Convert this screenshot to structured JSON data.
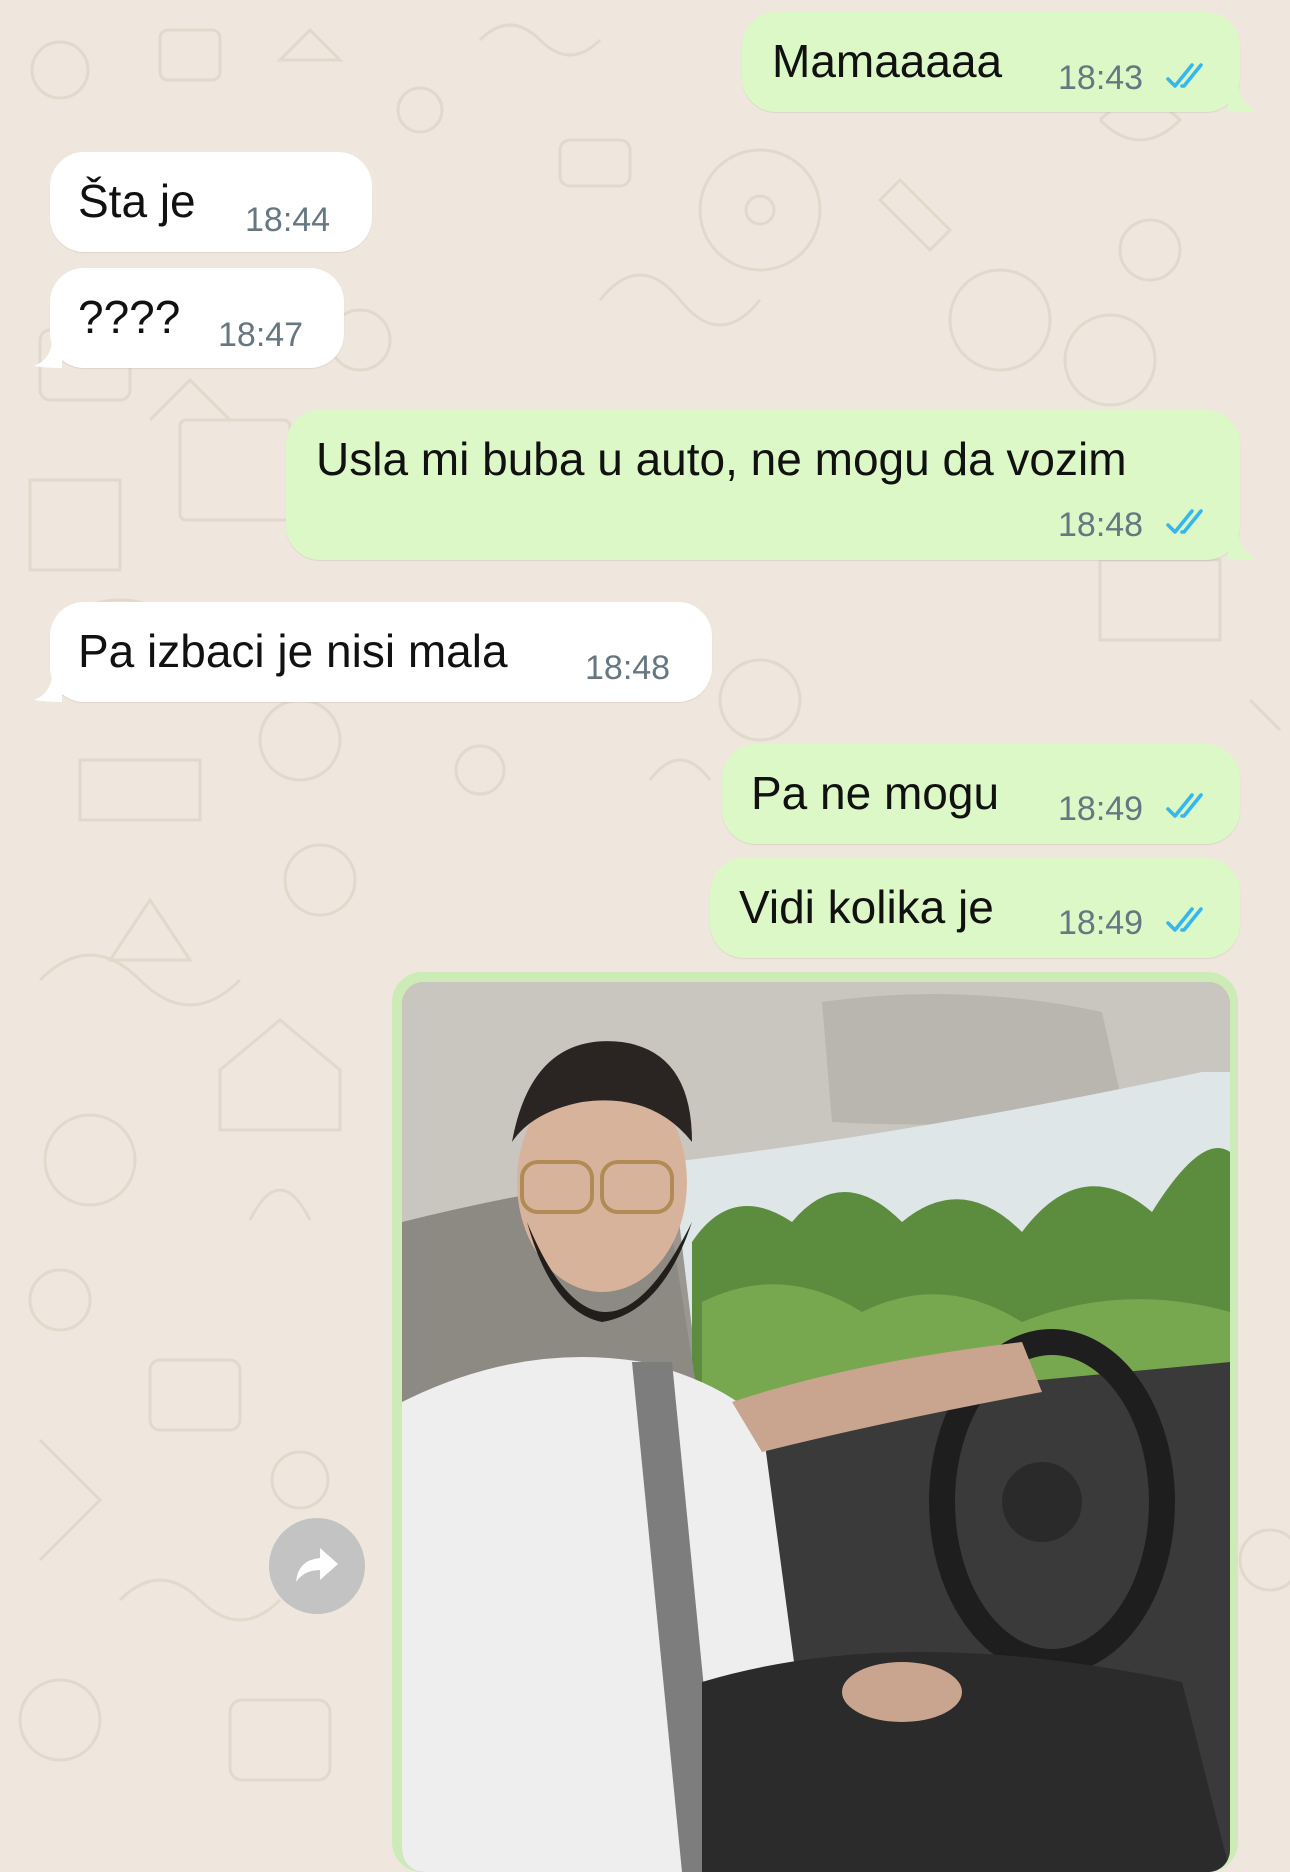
{
  "chat": {
    "messages": [
      {
        "id": "m1",
        "direction": "outgoing",
        "text": "Mamaaaaa",
        "time": "18:43",
        "status": "read"
      },
      {
        "id": "m2",
        "direction": "incoming",
        "text": "Šta je",
        "time": "18:44"
      },
      {
        "id": "m3",
        "direction": "incoming",
        "text": "????",
        "time": "18:47"
      },
      {
        "id": "m4",
        "direction": "outgoing",
        "text": "Usla mi buba u auto, ne mogu da vozim",
        "time": "18:48",
        "status": "read"
      },
      {
        "id": "m5",
        "direction": "incoming",
        "text": "Pa izbaci je nisi mala",
        "time": "18:48"
      },
      {
        "id": "m6",
        "direction": "outgoing",
        "text": "Pa ne mogu",
        "time": "18:49",
        "status": "read"
      },
      {
        "id": "m7",
        "direction": "outgoing",
        "text": "Vidi kolika je",
        "time": "18:49",
        "status": "read"
      },
      {
        "id": "m8",
        "direction": "outgoing",
        "type": "photo",
        "photo_subject": "man with beard and glasses in white t-shirt driving a car"
      }
    ]
  },
  "colors": {
    "background": "#efe7dd",
    "incoming_bubble": "#ffffff",
    "outgoing_bubble": "#dcf8c6",
    "read_ticks": "#34b7f1",
    "timestamp": "#667781"
  },
  "icons": {
    "read_receipt": "double-check-icon",
    "forward": "forward-arrow-icon"
  }
}
